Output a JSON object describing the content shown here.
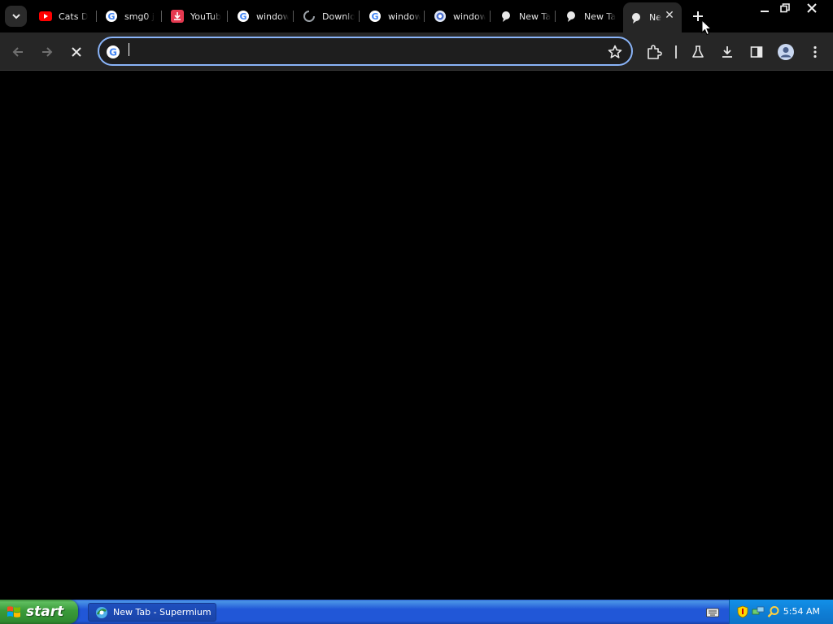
{
  "browser": {
    "tabs": [
      {
        "title": "Cats D",
        "icon": "youtube-icon"
      },
      {
        "title": "smg0 j",
        "icon": "google-icon"
      },
      {
        "title": "YouTub",
        "icon": "download-app-icon"
      },
      {
        "title": "window",
        "icon": "google-icon"
      },
      {
        "title": "Downlo",
        "icon": "loading-spinner-icon"
      },
      {
        "title": "window",
        "icon": "google-icon"
      },
      {
        "title": "window",
        "icon": "chrome-icon"
      },
      {
        "title": "New Ta",
        "icon": "newtab-icon"
      },
      {
        "title": "New Ta",
        "icon": "newtab-icon"
      },
      {
        "title": "Ne",
        "icon": "newtab-icon",
        "active": true
      }
    ],
    "omnibox": {
      "value": "",
      "placeholder": ""
    }
  },
  "taskbar": {
    "start_label": "start",
    "task_title": "New Tab - Supermium",
    "clock": "5:54 AM"
  },
  "colors": {
    "accent": "#8ab4f8",
    "taskbar": "#2157d7",
    "start": "#3a9b3a"
  }
}
